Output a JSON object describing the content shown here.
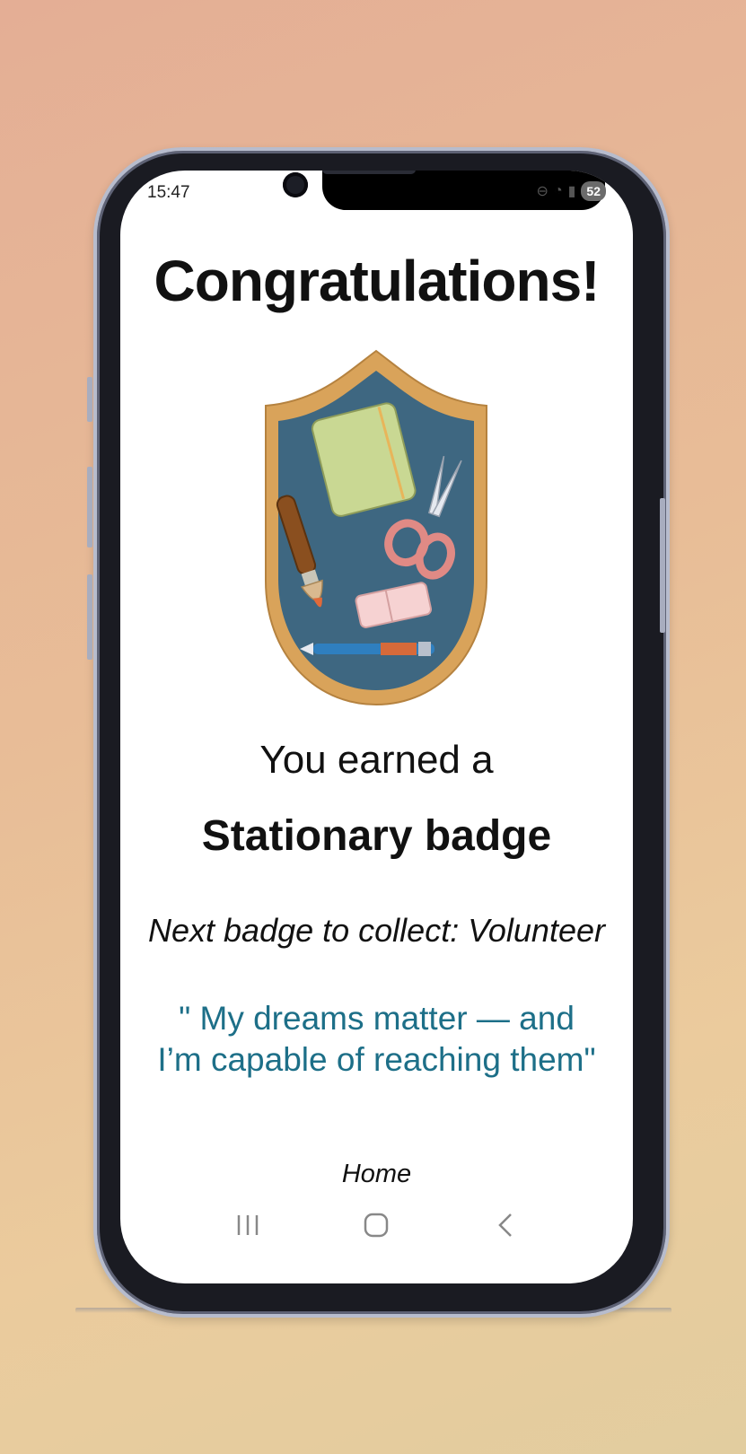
{
  "status_bar": {
    "time": "15:47",
    "battery": "52"
  },
  "screen": {
    "title": "Congratulations!",
    "earned_text": "You earned a",
    "badge_name": "Stationary badge",
    "next_badge": "Next badge to collect:  Volunteer",
    "quote": "\" My dreams matter — and I’m capable of reaching them\"",
    "home_link": "Home"
  },
  "badge": {
    "icon": "stationery-badge",
    "colors": {
      "border": "#d9a35a",
      "field": "#3e6781",
      "notebook": "#c9d893",
      "scissors": "#e08a85",
      "eraser": "#f2c2c2",
      "brush": "#8a4f1f",
      "pen": "#2f7fbf"
    }
  },
  "nav": {
    "icons": [
      "recent-apps-icon",
      "home-icon",
      "back-icon"
    ]
  }
}
